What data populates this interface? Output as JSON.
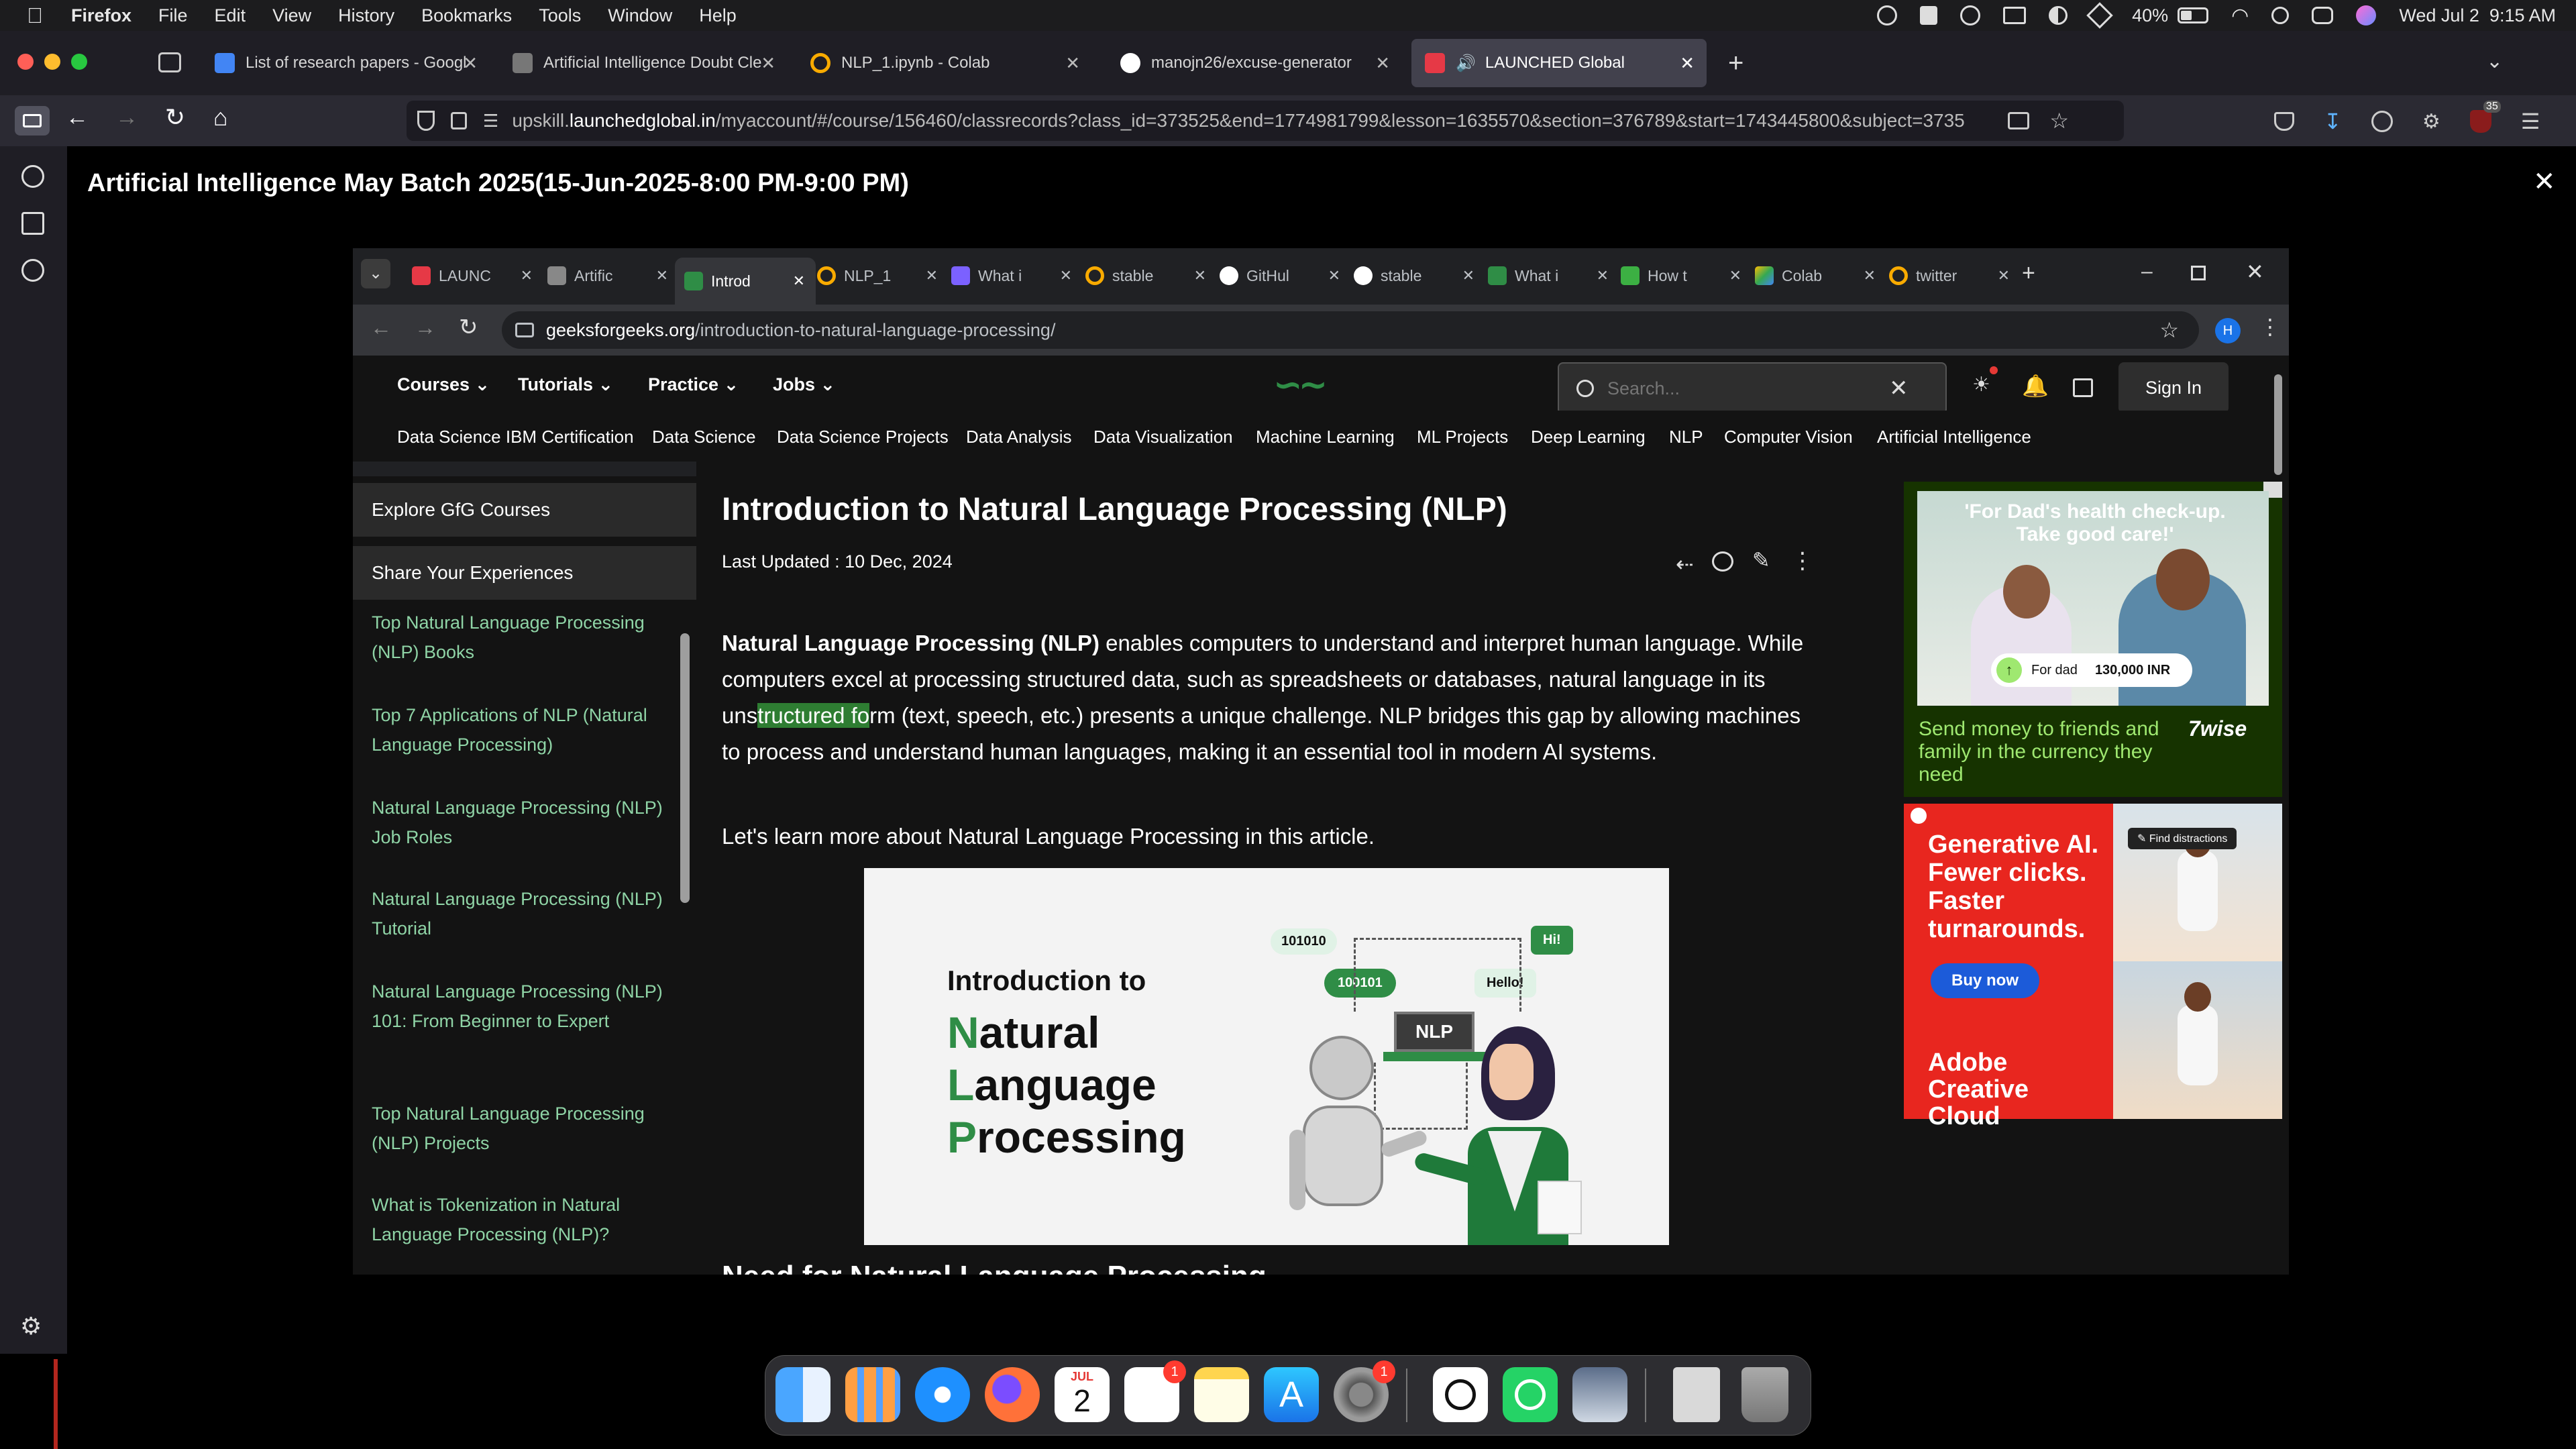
{
  "menubar": {
    "app": "Firefox",
    "items": [
      "File",
      "Edit",
      "View",
      "History",
      "Bookmarks",
      "Tools",
      "Window",
      "Help"
    ],
    "battery": "40%",
    "datetime": "Wed Jul 2  9:15 AM"
  },
  "firefox": {
    "tabs": [
      {
        "title": "List of research papers - Googl",
        "icon": "google-docs-icon",
        "color": "#4285f4"
      },
      {
        "title": "Artificial Intelligence Doubt Cle",
        "icon": "page-icon",
        "color": "#888888"
      },
      {
        "title": "NLP_1.ipynb - Colab",
        "icon": "colab-icon",
        "color": "#f9ab00"
      },
      {
        "title": "manojn26/excuse-generator",
        "icon": "github-icon",
        "color": "#ffffff"
      },
      {
        "title": "LAUNCHED Global",
        "icon": "launched-icon",
        "color": "#e63946"
      }
    ],
    "url_prefix": "upskill.",
    "url_domain": "launchedglobal.in",
    "url_rest": "/myaccount/#/course/156460/classrecords?class_id=373525&end=1774981799&lesson=1635570&section=376789&start=1743445800&subject=3735",
    "badge_count": "35"
  },
  "course": {
    "title": "Artificial Intelligence May Batch 2025(15-Jun-2025-8:00 PM-9:00 PM)",
    "close": "✕"
  },
  "inner": {
    "tabs": [
      "LAUNC",
      "Artific",
      "Introd",
      "NLP_1",
      "What i",
      "stable",
      "GitHul",
      "stable",
      "What i",
      "How t",
      "Colab",
      "twitter"
    ],
    "url_domain": "geeksforgeeks.org",
    "url_path": "/introduction-to-natural-language-processing/",
    "profile_letter": "H"
  },
  "gfg": {
    "nav": [
      "Courses",
      "Tutorials",
      "Practice",
      "Jobs"
    ],
    "search_placeholder": "Search...",
    "sign_in": "Sign In",
    "subnav": [
      "Data Science IBM Certification",
      "Data Science",
      "Data Science Projects",
      "Data Analysis",
      "Data Visualization",
      "Machine Learning",
      "ML Projects",
      "Deep Learning",
      "NLP",
      "Computer Vision",
      "Artificial Intelligence"
    ],
    "left": {
      "explore": "Explore GfG Courses",
      "share": "Share Your Experiences",
      "items": [
        "Top Natural Language Processing (NLP) Books",
        "Top 7 Applications of NLP (Natural Language Processing)",
        "Natural Language Processing (NLP) Job Roles",
        "Natural Language Processing (NLP) Tutorial",
        "Natural Language Processing (NLP) 101: From Beginner to Expert",
        "Top Natural Language Processing (NLP) Projects",
        "What is Tokenization in Natural Language Processing (NLP)?"
      ]
    },
    "article": {
      "title": "Introduction to Natural Language Processing (NLP)",
      "updated": "Last Updated : 10 Dec, 2024",
      "para_bold": "Natural Language Processing (NLP)",
      "para_1a": " enables computers to understand and interpret human language. While computers excel at processing structured data, such as spreadsheets or databases, natural language in its uns",
      "para_1_highlight": "tructured fo",
      "para_1b": "rm (text, speech, etc.) presents a unique challenge. NLP bridges this gap by allowing machines to process and understand human languages, making it an essential tool in modern AI systems.",
      "para_2": "Let's learn more about Natural Language Processing in this article.",
      "image": {
        "intro": "Introduction to",
        "line1_first": "N",
        "line1_rest": "atural",
        "line2_first": "L",
        "line2_rest": "anguage",
        "line3_first": "P",
        "line3_rest": "rocessing",
        "bubbles": [
          "101010",
          "100101",
          "Hello!",
          "Hi!",
          "NLP"
        ]
      },
      "next_heading": "Need for Natural Language Processing"
    },
    "ads": {
      "wise_quote": "'For Dad's health check-up. Take good care!'",
      "wise_chip_label": "For dad",
      "wise_chip_amount": "130,000 INR",
      "wise_text": "Send money to friends and family in the currency they need",
      "wise_brand": "7wise",
      "adobe_headline": "Generative AI. Fewer clicks. Faster turnarounds.",
      "adobe_button": "Buy now",
      "adobe_find": "Find distractions",
      "adobe_brand": "Adobe Creative Cloud"
    }
  },
  "dock": {
    "calendar_month": "JUL",
    "calendar_day": "2",
    "reminders_badge": "1",
    "settings_badge": "1"
  },
  "colors": {
    "gfg_green": "#2f8d46",
    "link_green": "#8fd4a6",
    "adobe_red": "#e8261f",
    "wise_green": "#9fe870",
    "highlight": "#2e7d32"
  }
}
